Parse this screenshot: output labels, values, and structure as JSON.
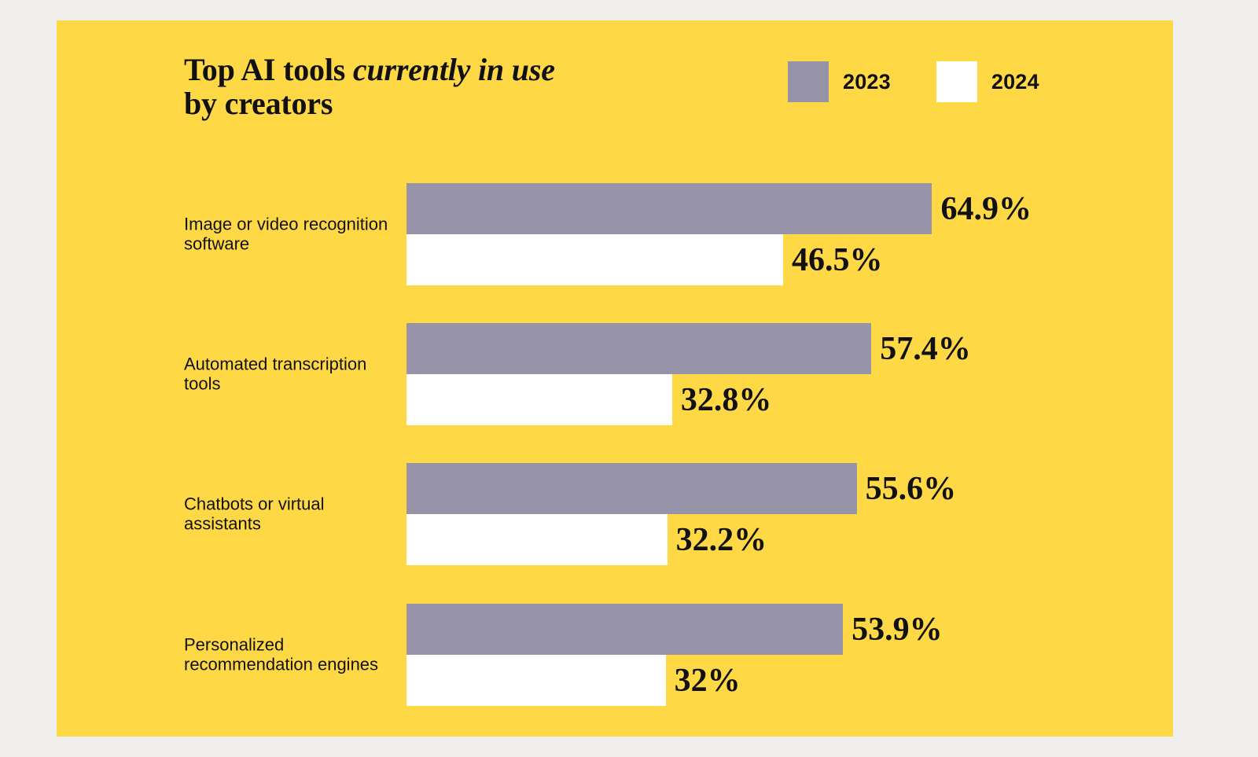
{
  "page": {
    "background_color": "#f0efeb",
    "card_background_color": "#ffd845"
  },
  "header": {
    "title_line1_plain": "Top AI tools ",
    "title_line1_italic": "currently in use",
    "title_line2": "by creators"
  },
  "legend": {
    "items": [
      {
        "label": "2023",
        "color": "#9793a8"
      },
      {
        "label": "2024",
        "color": "#ffffff"
      }
    ]
  },
  "chart_data": {
    "type": "bar",
    "title": "Top AI tools currently in use by creators",
    "orientation": "horizontal",
    "xlabel": "",
    "ylabel": "",
    "xlim": [
      0,
      70
    ],
    "grid": false,
    "legend_position": "top-right",
    "value_suffix": "%",
    "categories": [
      "Image or video recognition software",
      "Automated transcription tools",
      "Chatbots or virtual assistants",
      "Personalized recommendation engines"
    ],
    "series": [
      {
        "name": "2023",
        "color": "#9793a8",
        "values": [
          64.9,
          57.4,
          55.6,
          53.9
        ],
        "labels": [
          "64.9%",
          "57.4%",
          "55.6%",
          "53.9%"
        ]
      },
      {
        "name": "2024",
        "color": "#ffffff",
        "values": [
          46.5,
          32.8,
          32.2,
          32
        ],
        "labels": [
          "46.5%",
          "32.8%",
          "32.2%",
          "32%"
        ]
      }
    ]
  }
}
